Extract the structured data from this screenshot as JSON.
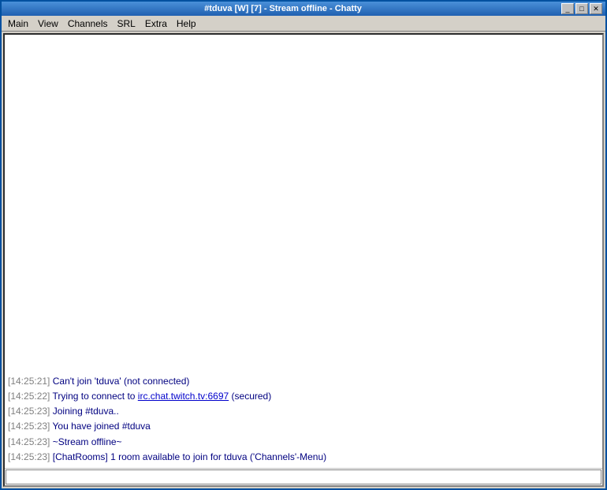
{
  "window": {
    "title": "#tduva [W] [7] - Stream offline - Chatty",
    "app_name": "Chatty"
  },
  "title_bar": {
    "text": "#tduva [W] [7] - Stream offline - Chatty",
    "minimize_label": "_",
    "maximize_label": "□",
    "close_label": "✕"
  },
  "menu_bar": {
    "items": [
      {
        "label": "Main"
      },
      {
        "label": "View"
      },
      {
        "label": "Channels"
      },
      {
        "label": "SRL"
      },
      {
        "label": "Extra"
      },
      {
        "label": "Help"
      }
    ]
  },
  "messages": [
    {
      "timestamp": "[14:25:21]",
      "text": " Can't join 'tduva' (not connected)"
    },
    {
      "timestamp": "[14:25:22]",
      "text_before": " Trying to connect to ",
      "link": "irc.chat.twitch.tv:6697",
      "text_after": " (secured)"
    },
    {
      "timestamp": "[14:25:23]",
      "text": " Joining #tduva.."
    },
    {
      "timestamp": "[14:25:23]",
      "text": " You have joined #tduva"
    },
    {
      "timestamp": "[14:25:23]",
      "text": " ~Stream offline~"
    },
    {
      "timestamp": "[14:25:23]",
      "text": " [ChatRooms] 1 room available to join for tduva ('Channels'-Menu)"
    }
  ],
  "input": {
    "placeholder": ""
  }
}
